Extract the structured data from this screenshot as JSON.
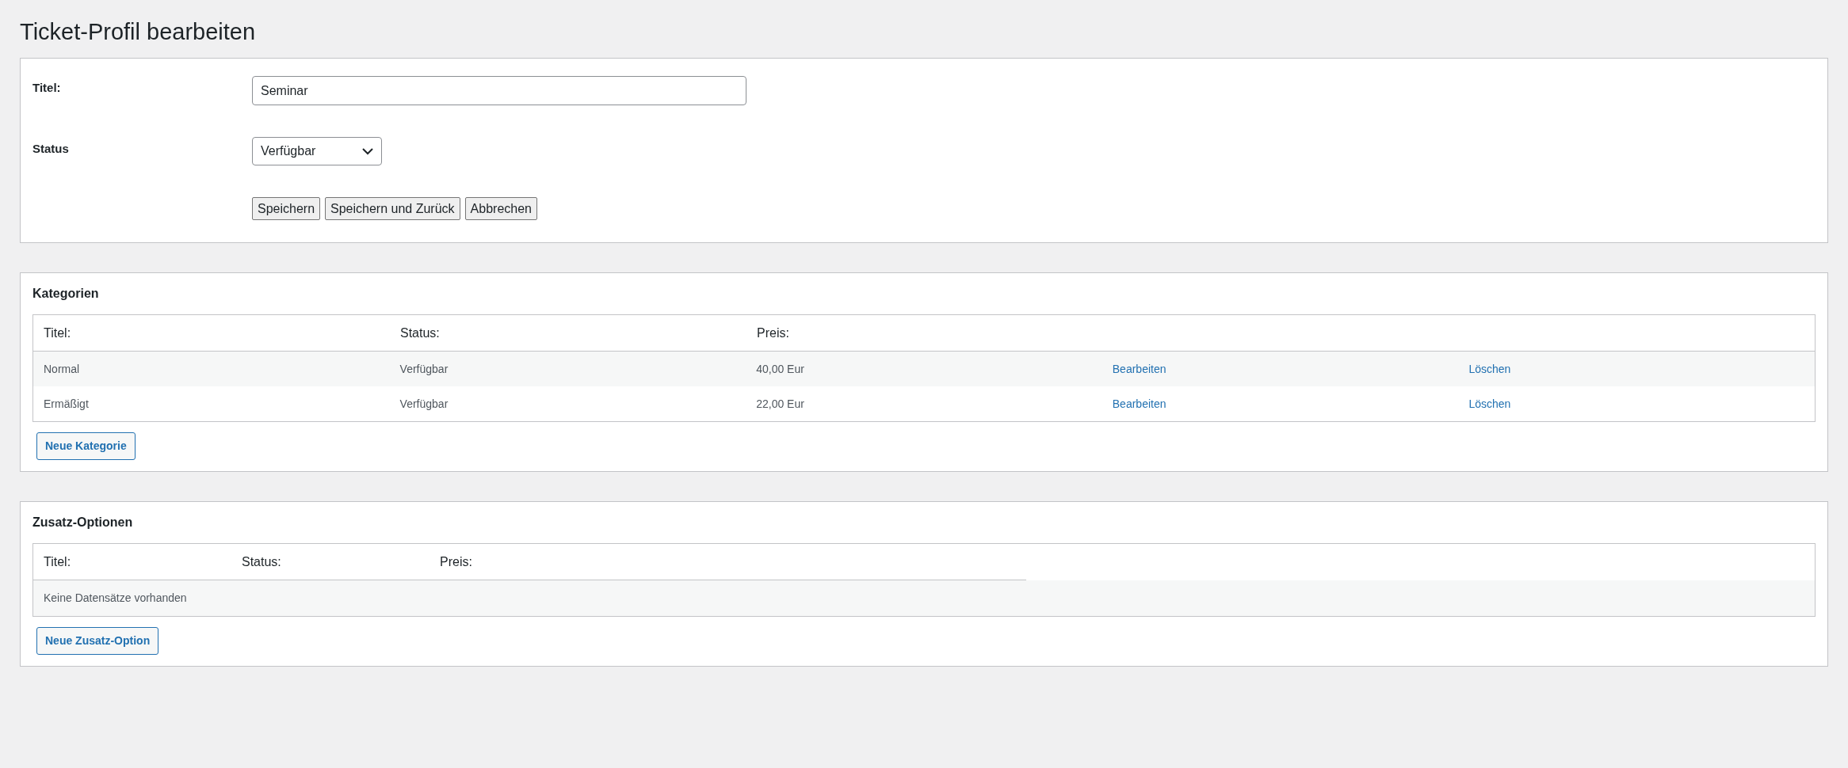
{
  "page_title": "Ticket-Profil bearbeiten",
  "form": {
    "title_label": "Titel:",
    "title_value": "Seminar",
    "status_label": "Status",
    "status_value": "Verfügbar",
    "buttons": [
      "Speichern",
      "Speichern und Zurück",
      "Abbrechen"
    ]
  },
  "categories": {
    "heading": "Kategorien",
    "columns": [
      "Titel:",
      "Status:",
      "Preis:"
    ],
    "rows": [
      {
        "title": "Normal",
        "status": "Verfügbar",
        "price": "40,00 Eur",
        "edit": "Bearbeiten",
        "delete": "Löschen"
      },
      {
        "title": "Ermäßigt",
        "status": "Verfügbar",
        "price": "22,00 Eur",
        "edit": "Bearbeiten",
        "delete": "Löschen"
      }
    ],
    "add_button": "Neue Kategorie"
  },
  "options": {
    "heading": "Zusatz-Optionen",
    "columns": [
      "Titel:",
      "Status:",
      "Preis:"
    ],
    "empty_text": "Keine Datensätze vorhanden",
    "add_button": "Neue Zusatz-Option"
  }
}
